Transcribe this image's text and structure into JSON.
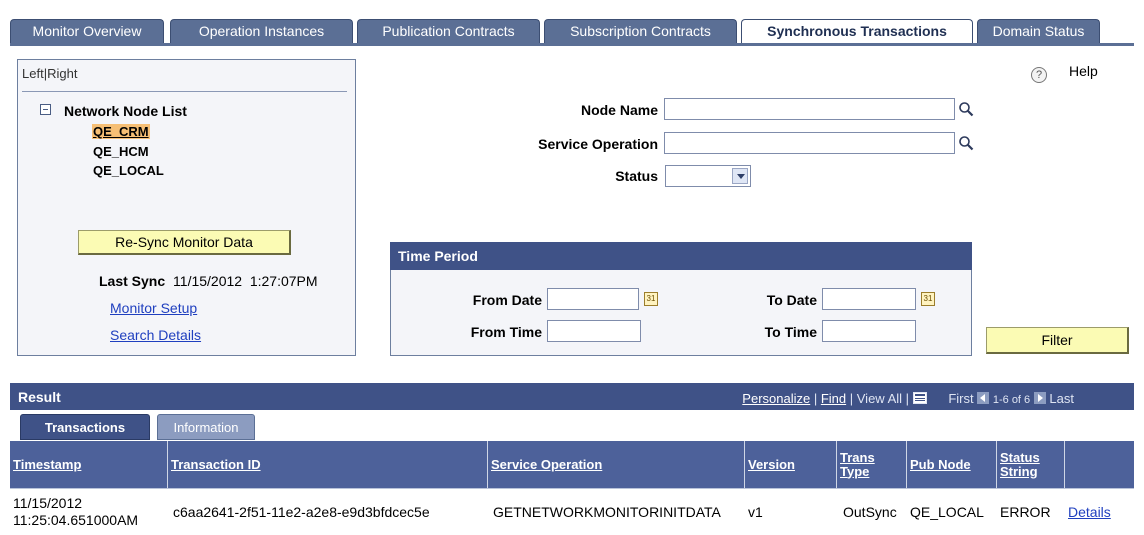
{
  "top_tabs": [
    {
      "label": "Monitor Overview",
      "active": false
    },
    {
      "label": "Operation Instances",
      "active": false
    },
    {
      "label": "Publication Contracts",
      "active": false
    },
    {
      "label": "Subscription Contracts",
      "active": false
    },
    {
      "label": "Synchronous Transactions",
      "active": true
    },
    {
      "label": "Domain Status",
      "active": false
    }
  ],
  "left_panel": {
    "left_label": "Left",
    "separator": "|",
    "right_label": "Right",
    "node_list_title": "Network Node List",
    "nodes": [
      "QE_CRM",
      "QE_HCM",
      "QE_LOCAL"
    ],
    "selected_node": "QE_CRM",
    "resync_button": "Re-Sync Monitor Data",
    "last_sync_label": "Last Sync",
    "last_sync_value": "11/15/2012  1:27:07PM",
    "monitor_setup_link": "Monitor Setup",
    "search_details_link": "Search Details"
  },
  "search": {
    "node_name_label": "Node Name",
    "node_name_value": "",
    "service_operation_label": "Service Operation",
    "service_operation_value": "",
    "status_label": "Status",
    "status_value": "",
    "help_icon": "?",
    "help_label": "Help"
  },
  "time_period": {
    "title": "Time Period",
    "from_date_label": "From Date",
    "from_date_value": "",
    "to_date_label": "To Date",
    "to_date_value": "",
    "from_time_label": "From Time",
    "from_time_value": "",
    "to_time_label": "To Time",
    "to_time_value": "",
    "calendar_icon_text": "31"
  },
  "filter_button": "Filter",
  "result": {
    "title": "Result",
    "personalize": "Personalize",
    "find": "Find",
    "view_all": "View All",
    "first": "First",
    "range": "1-6 of 6",
    "last": "Last",
    "tabs": [
      {
        "label": "Transactions",
        "active": true
      },
      {
        "label": "Information",
        "active": false
      }
    ],
    "columns": [
      "Timestamp",
      "Transaction ID",
      "Service Operation",
      "Version",
      "Trans Type",
      "Pub Node",
      "Status String",
      ""
    ],
    "rows": [
      {
        "timestamp_date": "11/15/2012",
        "timestamp_time": "11:25:04.651000AM",
        "transaction_id": "c6aa2641-2f51-11e2-a2e8-e9d3bfdcec5e",
        "service_operation": "GETNETWORKMONITORINITDATA",
        "version": "v1",
        "trans_type": "OutSync",
        "pub_node": "QE_LOCAL",
        "status": "ERROR",
        "details": "Details"
      }
    ]
  },
  "colors": {
    "tab_blue": "#5b6f95",
    "header_blue": "#3f5287",
    "button_yellow": "#fbfbb4",
    "link_blue": "#1f3fbf",
    "selected_node_bg": "#f6bf75"
  }
}
